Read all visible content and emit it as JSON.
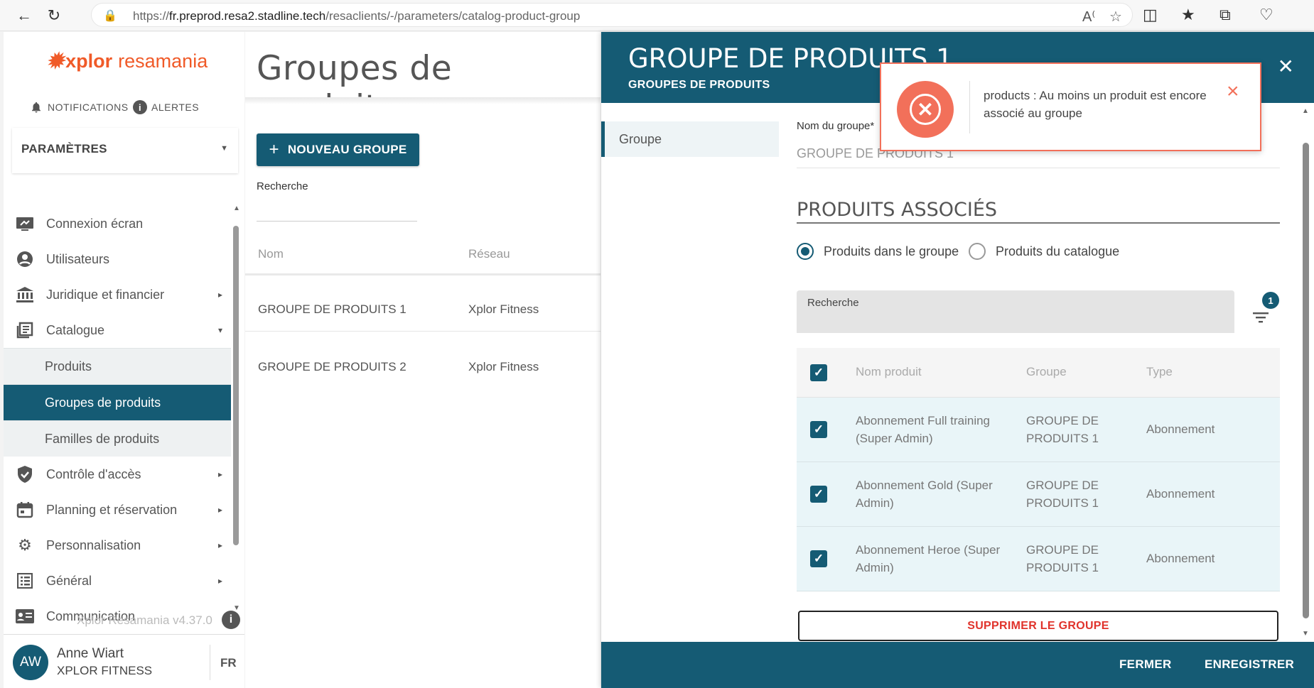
{
  "browser": {
    "url_prefix": "https://",
    "url_host": "fr.preprod.resa2.stadline.tech",
    "url_path": "/resaclients/-/parameters/catalog-product-group"
  },
  "sidebar": {
    "logo_word1": "xplor",
    "logo_word2": "resamania",
    "notifications": "NOTIFICATIONS",
    "alerts": "ALERTES",
    "section": "PARAMÈTRES",
    "menu": [
      {
        "label": "Connexion écran",
        "icon": "screen-connection-icon"
      },
      {
        "label": "Utilisateurs",
        "icon": "user-icon"
      },
      {
        "label": "Juridique et financier",
        "icon": "bank-icon"
      },
      {
        "label": "Catalogue",
        "icon": "catalog-icon"
      }
    ],
    "submenu": [
      {
        "label": "Produits"
      },
      {
        "label": "Groupes de produits"
      },
      {
        "label": "Familles de produits"
      }
    ],
    "menu2": [
      {
        "label": "Contrôle d'accès",
        "icon": "shield-check-icon"
      },
      {
        "label": "Planning et réservation",
        "icon": "calendar-icon"
      },
      {
        "label": "Personnalisation",
        "icon": "gear-icon"
      },
      {
        "label": "Général",
        "icon": "list-icon"
      },
      {
        "label": "Communication",
        "icon": "contact-card-icon"
      }
    ],
    "version": "Xplor Resamania v4.37.0",
    "user_initials": "AW",
    "user_name": "Anne Wiart",
    "user_org": "XPLOR FITNESS",
    "lang": "FR"
  },
  "main": {
    "title": "Groupes de produits",
    "new_button": "NOUVEAU GROUPE",
    "search_label": "Recherche",
    "columns": [
      "Nom",
      "Réseau"
    ],
    "rows": [
      {
        "name": "GROUPE DE PRODUITS 1",
        "network": "Xplor Fitness"
      },
      {
        "name": "GROUPE DE PRODUITS 2",
        "network": "Xplor Fitness"
      }
    ]
  },
  "panel": {
    "title": "GROUPE DE PRODUITS 1",
    "subtitle": "GROUPES DE PRODUITS",
    "tab": "Groupe",
    "field_label": "Nom du groupe*",
    "field_value": "GROUPE DE PRODUITS 1",
    "section_title": "PRODUITS ASSOCIÉS",
    "radio_in_group": "Produits dans le groupe",
    "radio_catalog": "Produits du catalogue",
    "search_label": "Recherche",
    "filter_count": "1",
    "table_headers": [
      "Nom produit",
      "Groupe",
      "Type"
    ],
    "table_rows": [
      {
        "name_l1": "Abonnement Full training",
        "name_l2": "(Super Admin)",
        "group_l1": "GROUPE DE",
        "group_l2": "PRODUITS 1",
        "type": "Abonnement"
      },
      {
        "name_l1": "Abonnement Gold (Super",
        "name_l2": "Admin)",
        "group_l1": "GROUPE DE",
        "group_l2": "PRODUITS 1",
        "type": "Abonnement"
      },
      {
        "name_l1": "Abonnement Heroe (Super",
        "name_l2": "Admin)",
        "group_l1": "GROUPE DE",
        "group_l2": "PRODUITS 1",
        "type": "Abonnement"
      }
    ],
    "delete_button": "SUPPRIMER LE GROUPE",
    "close_button": "FERMER",
    "save_button": "ENREGISTRER"
  },
  "toast": {
    "message": "products : Au moins un produit est encore associé au groupe"
  },
  "colors": {
    "primary": "#155b74",
    "brand": "#f05a28",
    "error": "#f2705a",
    "danger_text": "#e0332b"
  }
}
